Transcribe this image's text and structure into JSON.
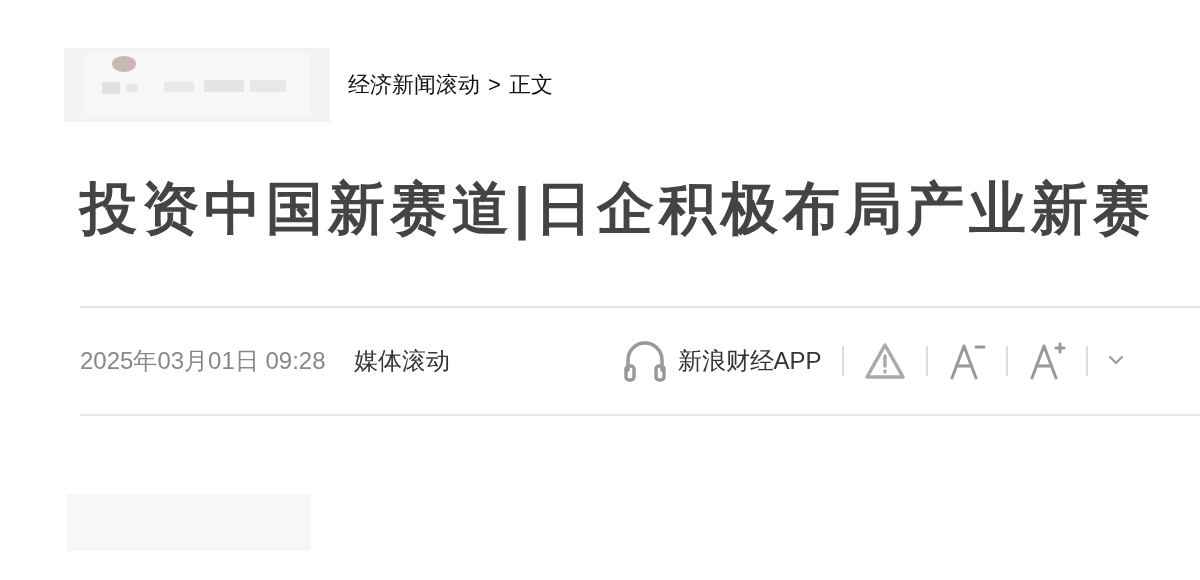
{
  "header": {
    "breadcrumb": [
      {
        "label": "经济新闻滚动"
      },
      {
        "label": ">"
      },
      {
        "label": "正文"
      }
    ]
  },
  "article": {
    "title": "投资中国新赛道|日企积极布局产业新赛",
    "date": "2025年03月01日 09:28",
    "source": "媒体滚动"
  },
  "toolbar": [
    {
      "kind": "app",
      "label": "新浪财经APP"
    },
    {
      "kind": "report"
    },
    {
      "kind": "font-smaller"
    },
    {
      "kind": "font-larger"
    },
    {
      "kind": "more"
    }
  ]
}
